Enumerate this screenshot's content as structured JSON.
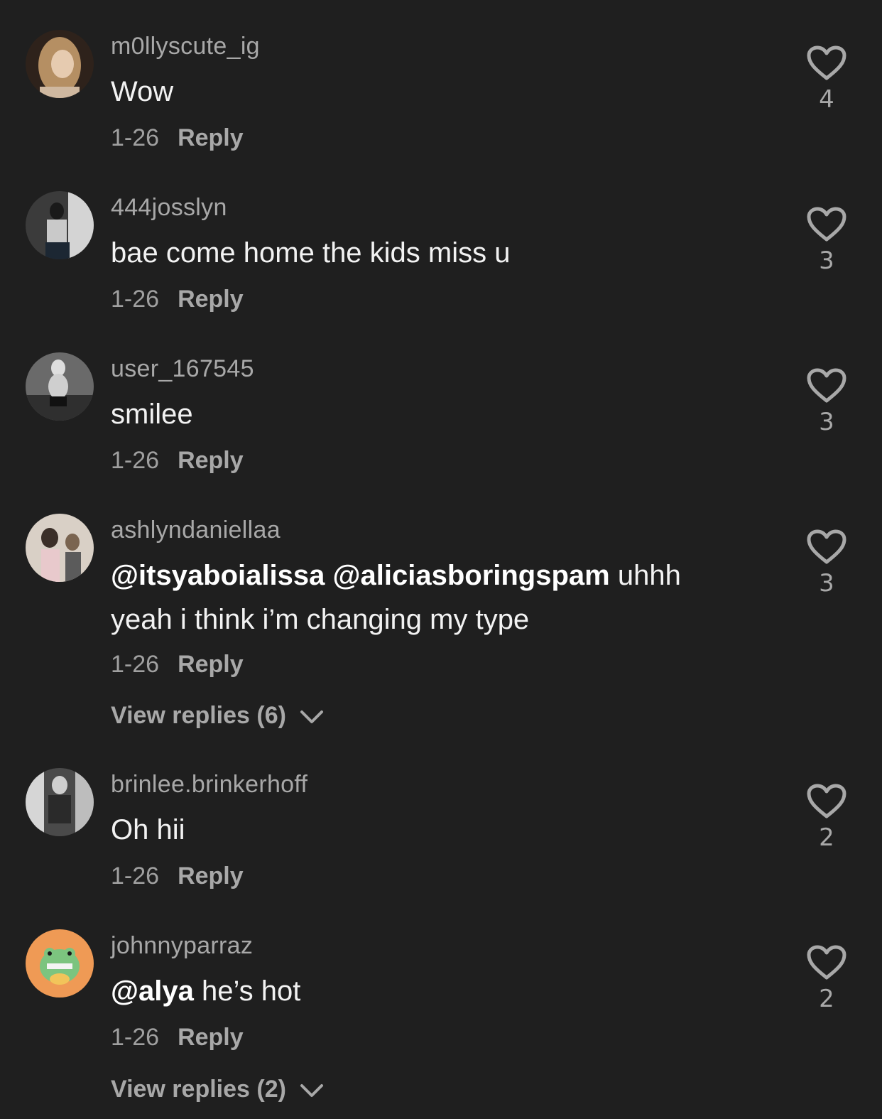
{
  "comments": [
    {
      "username": "m0llyscute_ig",
      "segments": [
        {
          "t": "Wow",
          "bold": false
        }
      ],
      "date": "1-26",
      "reply_label": "Reply",
      "likes": "4",
      "avatar_colors": [
        "#3a2c22",
        "#d8c2a6"
      ]
    },
    {
      "username": "444josslyn",
      "segments": [
        {
          "t": "bae come home the kids miss u",
          "bold": false
        }
      ],
      "date": "1-26",
      "reply_label": "Reply",
      "likes": "3",
      "avatar_colors": [
        "#2a2a2a",
        "#bdbdbd"
      ]
    },
    {
      "username": "user_167545",
      "segments": [
        {
          "t": "smilee",
          "bold": false
        }
      ],
      "date": "1-26",
      "reply_label": "Reply",
      "likes": "3",
      "avatar_colors": [
        "#555555",
        "#e0e0e0"
      ]
    },
    {
      "username": "ashlyndaniellaa",
      "segments": [
        {
          "t": "@itsyaboialissa",
          "bold": true
        },
        {
          "t": " ",
          "bold": false
        },
        {
          "t": "@aliciasboringspam",
          "bold": true
        },
        {
          "t": " uhhh yeah i think i’m changing my type",
          "bold": false
        }
      ],
      "date": "1-26",
      "reply_label": "Reply",
      "likes": "3",
      "view_replies": "View replies (6)",
      "avatar_colors": [
        "#cfc3b6",
        "#6b5a4e"
      ]
    },
    {
      "username": "brinlee.brinkerhoff",
      "segments": [
        {
          "t": "Oh hii",
          "bold": false
        }
      ],
      "date": "1-26",
      "reply_label": "Reply",
      "likes": "2",
      "avatar_colors": [
        "#3a3a3a",
        "#cfcfcf"
      ]
    },
    {
      "username": "johnnyparraz",
      "segments": [
        {
          "t": "@alya",
          "bold": true
        },
        {
          "t": " he’s hot",
          "bold": false
        }
      ],
      "date": "1-26",
      "reply_label": "Reply",
      "likes": "2",
      "view_replies": "View replies (2)",
      "avatar_colors": [
        "#ef9a55",
        "#6fbf73"
      ]
    }
  ]
}
